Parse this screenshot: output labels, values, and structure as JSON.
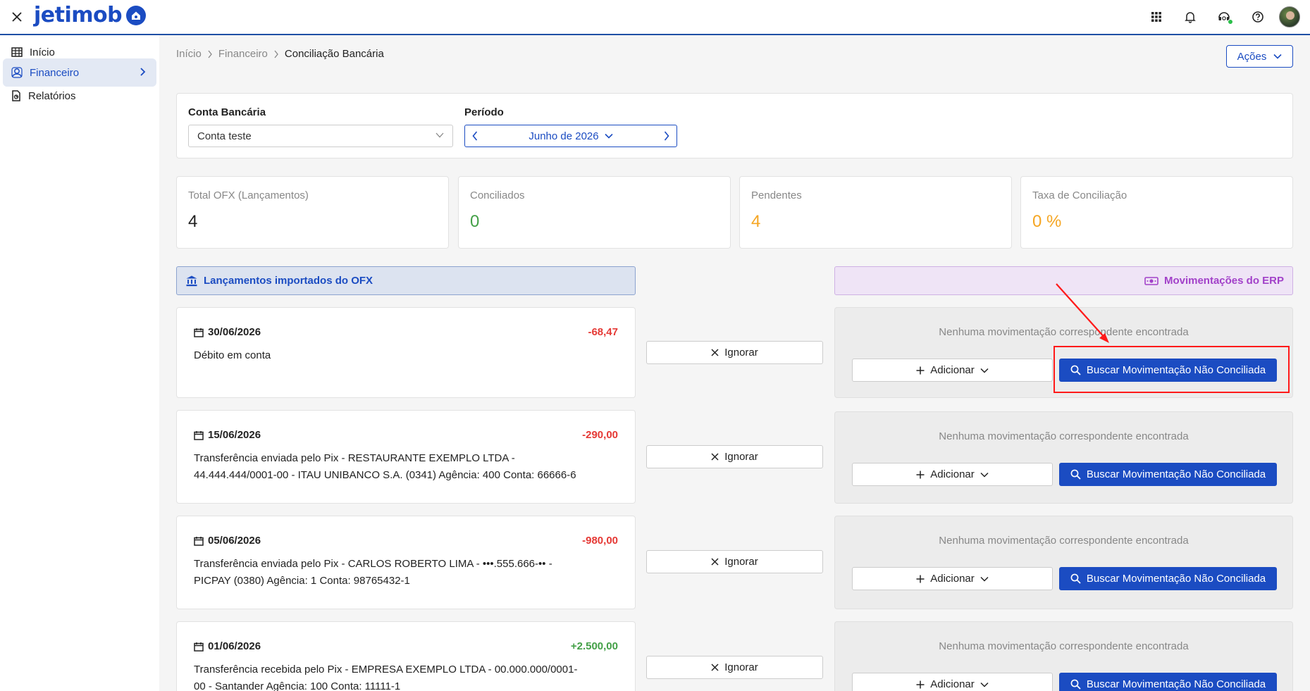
{
  "header": {
    "logo_text": "jetimob",
    "icons": [
      "close-icon",
      "apps-grid-icon",
      "bell-icon",
      "support-icon",
      "help-icon",
      "avatar"
    ],
    "brand_color": "#1b4cc2"
  },
  "sidebar": {
    "items": [
      {
        "label": "Início",
        "icon": "grid-table-icon"
      },
      {
        "label": "Financeiro",
        "icon": "finance-icon"
      },
      {
        "label": "Relatórios",
        "icon": "report-icon"
      }
    ]
  },
  "breadcrumb": {
    "items": [
      "Início",
      "Financeiro"
    ],
    "current": "Conciliação Bancária"
  },
  "actions_label": "Ações",
  "filters": {
    "bank_label": "Conta Bancária",
    "bank_value": "Conta teste",
    "period_label": "Período",
    "period_value": "Junho de 2026"
  },
  "stats": [
    {
      "label": "Total OFX (Lançamentos)",
      "value": "4",
      "color": "#1f1f1f"
    },
    {
      "label": "Conciliados",
      "value": "0",
      "color": "#43a047"
    },
    {
      "label": "Pendentes",
      "value": "4",
      "color": "#f5a623"
    },
    {
      "label": "Taxa de Conciliação",
      "value": "0 %",
      "color": "#f5a623"
    }
  ],
  "panels": {
    "ofx_title": "Lançamentos importados do OFX",
    "erp_title": "Movimentações do ERP"
  },
  "transactions": [
    {
      "date": "30/06/2026",
      "amount": "-68,47",
      "sign": "neg",
      "description": "Débito em conta"
    },
    {
      "date": "15/06/2026",
      "amount": "-290,00",
      "sign": "neg",
      "description": "Transferência enviada pelo Pix - RESTAURANTE EXEMPLO LTDA - 44.444.444/0001-00 - ITAU UNIBANCO S.A. (0341) Agência: 400 Conta: 66666-6"
    },
    {
      "date": "05/06/2026",
      "amount": "-980,00",
      "sign": "neg",
      "description": "Transferência enviada pelo Pix - CARLOS ROBERTO LIMA - •••.555.666-•• - PICPAY (0380) Agência: 1 Conta: 98765432-1"
    },
    {
      "date": "01/06/2026",
      "amount": "+2.500,00",
      "sign": "pos",
      "description": "Transferência recebida pelo Pix - EMPRESA EXEMPLO LTDA - 00.000.000/0001-00 - Santander Agência: 100 Conta: 11111-1"
    }
  ],
  "row_actions": {
    "ignore_label": "Ignorar",
    "no_match_text": "Nenhuma movimentação correspondente encontrada",
    "add_label": "Adicionar",
    "search_label": "Buscar Movimentação Não Conciliada"
  }
}
